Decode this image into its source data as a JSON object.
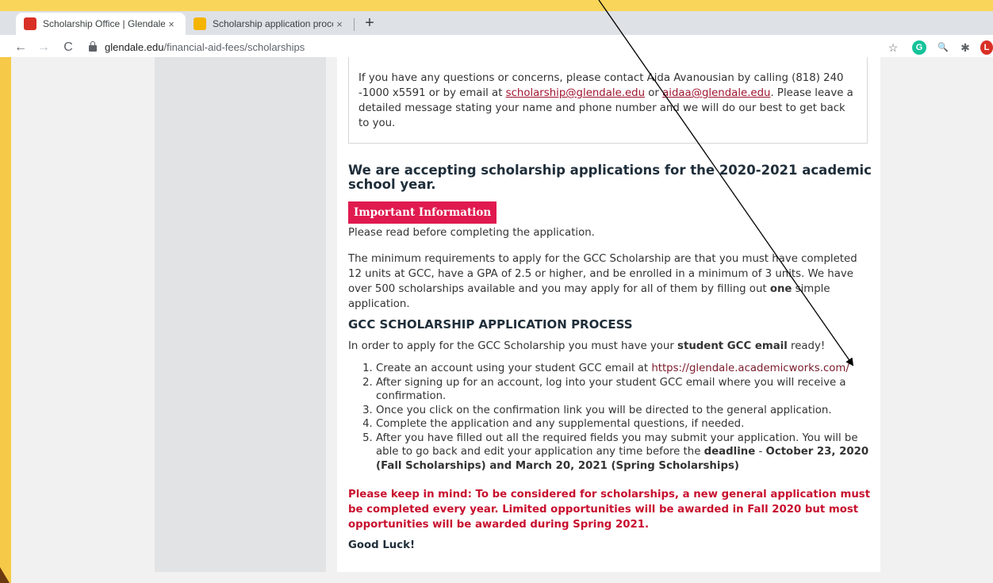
{
  "browser": {
    "tabs": [
      {
        "title": "Scholarship Office | Glendale C",
        "close": "×",
        "favicon_color": "#d93025",
        "active": true
      },
      {
        "title": "Scholarship application proces",
        "close": "×",
        "favicon_color": "#f4b400",
        "active": false
      }
    ],
    "new_tab": "+",
    "nav": {
      "back": "←",
      "forward": "→",
      "reload": "C"
    },
    "url": {
      "domain": "glendale.edu",
      "path": "/financial-aid-fees/scholarships"
    },
    "extensions": {
      "star": "☆",
      "grammarly": "G",
      "zoom": "🔍",
      "puzzle": "✱",
      "profile": "L"
    }
  },
  "info_box": {
    "pre": "If you have any questions or concerns, please contact Aida Avanousian by calling (818) 240 -1000 x5591 or by email at ",
    "link1": "scholarship@glendale.edu",
    "mid": " or ",
    "link2": "aidaa@glendale.edu",
    "post": ". Please leave a detailed message stating your name and phone number and we will do our best to get back to you."
  },
  "heading": "We are accepting scholarship applications for the 2020-2021 academic school year.",
  "important_badge": "Important Information",
  "read_before": "Please read before completing the application.",
  "requirements": {
    "pre": "The minimum requirements to apply for the GCC Scholarship are that you must have completed 12 units at GCC, have a GPA of 2.5 or higher, and be enrolled in a minimum of 3 units. We have over 500 scholarships available and you may apply for all of them by filling out ",
    "bold": "one",
    "post": " simple application."
  },
  "process_heading": "GCC SCHOLARSHIP APPLICATION PROCESS",
  "process_intro": {
    "pre": "In order to apply for the GCC Scholarship you must have your ",
    "bold": "student GCC email",
    "post": " ready!"
  },
  "steps": {
    "s1_pre": "Create an account using your student GCC email at ",
    "s1_link": "https://glendale.academicworks.com/",
    "s2": "After signing up for an account, log into your student GCC email where you will receive a confirmation.",
    "s3": "Once you click on the confirmation link you will be directed to the general application.",
    "s4": "Complete the application and any supplemental questions, if needed.",
    "s5_pre": "After you have filled out all the required fields you may submit your application. You will be able to go back and edit your application any time before the ",
    "s5_bold1": "deadline",
    "s5_mid": " - ",
    "s5_bold2": "October 23, 2020 (Fall Scholarships) and March 20, 2021 (Spring Scholarships)"
  },
  "notice": "Please keep in mind: To be considered for scholarships, a new general application must be completed every year. Limited opportunities will be awarded in Fall 2020 but most opportunities will be awarded during Spring 2021.",
  "good_luck": "Good Luck!",
  "colors": {
    "accent": "#e01a4f",
    "link": "#a0152f",
    "notice": "#c8102e",
    "frame": "#f7c948"
  }
}
